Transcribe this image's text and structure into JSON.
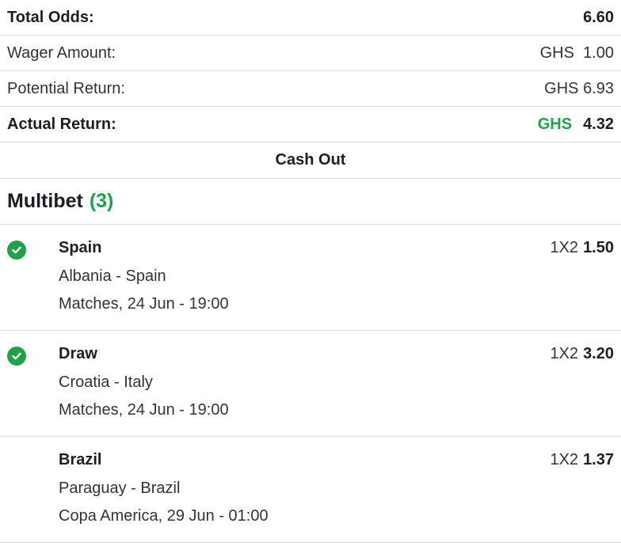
{
  "summary": {
    "total_odds_label": "Total Odds:",
    "total_odds_value": "6.60",
    "wager_label": "Wager Amount:",
    "wager_currency": "GHS",
    "wager_value": "1.00",
    "potential_label": "Potential Return:",
    "potential_value": "GHS 6.93",
    "actual_label": "Actual Return:",
    "actual_currency": "GHS",
    "actual_value": "4.32"
  },
  "cashout": {
    "label": "Cash Out"
  },
  "multibet": {
    "title": "Multibet",
    "count": "(3)"
  },
  "bets": [
    {
      "selection": "Spain",
      "event": "Albania - Spain",
      "meta": "Matches, 24 Jun - 19:00",
      "market": "1X2",
      "odds": "1.50",
      "won": true
    },
    {
      "selection": "Draw",
      "event": "Croatia - Italy",
      "meta": "Matches, 24 Jun - 19:00",
      "market": "1X2",
      "odds": "3.20",
      "won": true
    },
    {
      "selection": "Brazil",
      "event": "Paraguay - Brazil",
      "meta": "Copa America, 29 Jun - 01:00",
      "market": "1X2",
      "odds": "1.37",
      "won": false
    }
  ],
  "colors": {
    "accent_green": "#1fa34a",
    "divider": "#d8d8d8"
  },
  "icons": {
    "won": "check-circle-icon"
  }
}
